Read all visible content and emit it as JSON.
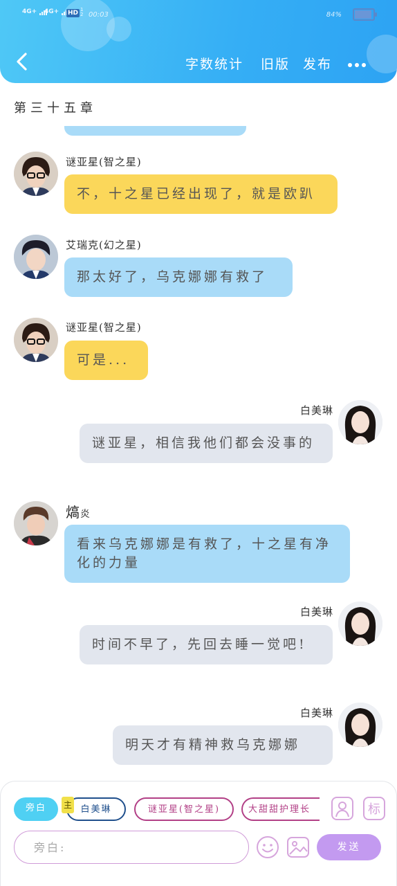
{
  "status_bar": {
    "network_1": "4G+",
    "network_2": "4G+",
    "hd": "HD",
    "hd_sub_1": "1",
    "hd_sub_2": "2",
    "time": "00:03",
    "battery_percent": "84%",
    "battery_level": 0.84
  },
  "header": {
    "word_count_label": "字数统计",
    "old_version_label": "旧版",
    "publish_label": "发布"
  },
  "chapter": {
    "title": "第三十五章"
  },
  "messages": [
    {
      "side": "left",
      "name": "谜亚星(智之星)",
      "text": "不，十之星已经出现了，就是欧趴",
      "color": "yellow"
    },
    {
      "side": "left",
      "name": "艾瑞克(幻之星)",
      "text": "那太好了，乌克娜娜有救了",
      "color": "blue"
    },
    {
      "side": "left",
      "name": "谜亚星(智之星)",
      "text": "可是...",
      "color": "yellow"
    },
    {
      "side": "right",
      "name": "白美琳",
      "text": "谜亚星，相信我他们都会没事的",
      "color": "gray"
    },
    {
      "side": "left",
      "name_main": "熇",
      "name_suffix": "炎",
      "text": "看来乌克娜娜是有救了，十之星有净化的力量",
      "color": "blue"
    },
    {
      "side": "right",
      "name": "白美琳",
      "text": "时间不早了，先回去睡一觉吧!",
      "color": "gray"
    },
    {
      "side": "right",
      "name": "白美琳",
      "text": "明天才有精神救乌克娜娜",
      "color": "gray"
    }
  ],
  "characters": {
    "narration": "旁白",
    "main_badge": "主",
    "items": [
      "白美琳",
      "谜亚星(智之星)",
      "大甜甜护理长"
    ]
  },
  "input": {
    "placeholder": "旁白:",
    "value": ""
  },
  "send_label": "发送",
  "colors": {
    "header_gradient_start": "#4fc8f6",
    "header_gradient_end": "#2da3f3",
    "bubble_yellow": "#fbd75a",
    "bubble_blue": "#a9dbf8",
    "bubble_gray": "#e2e6ee",
    "send_button": "#c39af0",
    "narration_chip": "#4fd0f3"
  }
}
